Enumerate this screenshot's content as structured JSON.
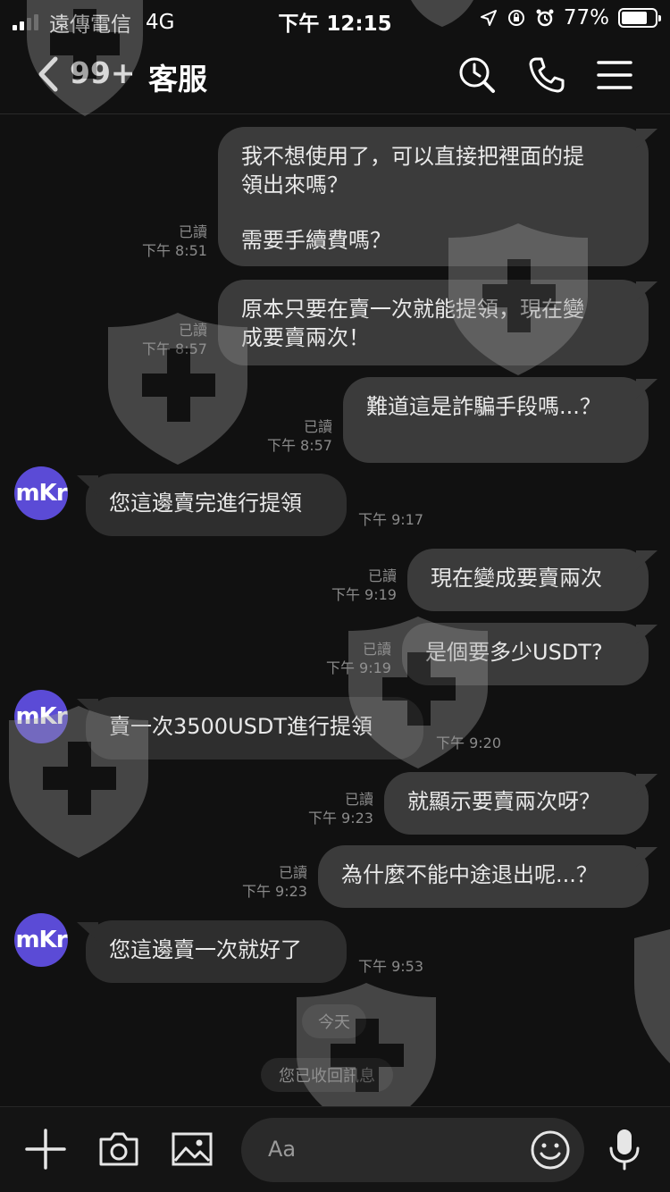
{
  "status_bar": {
    "carrier": "遠傳電信",
    "network": "4G",
    "time": "下午 12:15",
    "battery": "77%",
    "battery_level": 0.77
  },
  "header": {
    "unread_count": "99+",
    "title": "客服"
  },
  "messages": [
    {
      "side": "out",
      "lines": [
        "我不想使用了，可以直接把裡面的提",
        "領出來嗎？",
        "",
        "需要手續費嗎？"
      ],
      "read": "已讀",
      "time": "下午 8:51"
    },
    {
      "side": "out",
      "lines": [
        "原本只要在賣一次就能提領，現在變",
        "成要賣兩次！"
      ],
      "read": "已讀",
      "time": "下午 8:57"
    },
    {
      "side": "out",
      "lines": [
        "難道這是詐騙手段嗎...？"
      ],
      "read": "已讀",
      "time": "下午 8:57"
    },
    {
      "side": "in",
      "avatar": "mKr",
      "lines": [
        "您這邊賣完進行提領"
      ],
      "time": "下午 9:17"
    },
    {
      "side": "out",
      "lines": [
        "現在變成要賣兩次"
      ],
      "read": "已讀",
      "time": "下午 9:19"
    },
    {
      "side": "out",
      "lines": [
        "是個要多少USDT?"
      ],
      "read": "已讀",
      "time": "下午 9:19"
    },
    {
      "side": "in",
      "avatar": "mKr",
      "lines": [
        "賣一次3500USDT進行提領"
      ],
      "time": "下午 9:20"
    },
    {
      "side": "out",
      "lines": [
        "就顯示要賣兩次呀？"
      ],
      "read": "已讀",
      "time": "下午 9:23"
    },
    {
      "side": "out",
      "lines": [
        "為什麼不能中途退出呢...？"
      ],
      "read": "已讀",
      "time": "下午 9:23"
    },
    {
      "side": "in",
      "avatar": "mKr",
      "lines": [
        "您這邊賣一次就好了"
      ],
      "time": "下午 9:53"
    }
  ],
  "date_divider": "今天",
  "system_notice": "您已收回訊息",
  "composer": {
    "placeholder": "Aa"
  },
  "colors": {
    "background": "#111111",
    "bubble": "#3b3b3b",
    "avatar": "#5b4bd6",
    "meta_text": "#8a8a8a"
  }
}
